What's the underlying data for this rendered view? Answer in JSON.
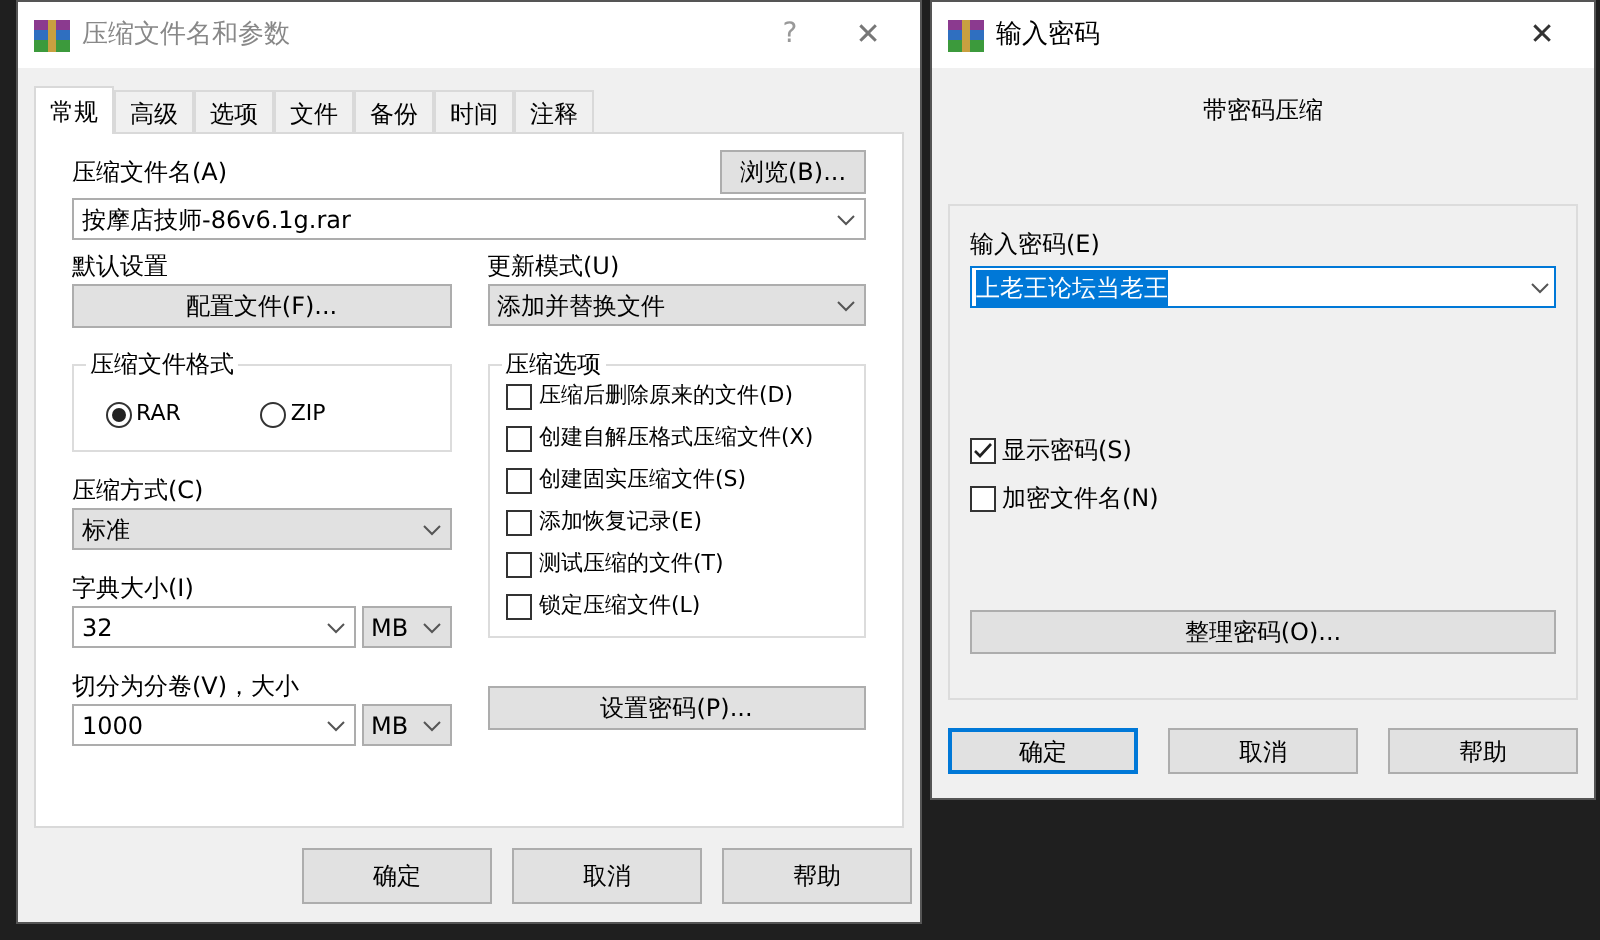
{
  "main_dialog": {
    "title": "压缩文件名和参数",
    "help_glyph": "?",
    "close_glyph": "✕",
    "tabs": [
      {
        "label": "常规",
        "selected": true
      },
      {
        "label": "高级",
        "selected": false
      },
      {
        "label": "选项",
        "selected": false
      },
      {
        "label": "文件",
        "selected": false
      },
      {
        "label": "备份",
        "selected": false
      },
      {
        "label": "时间",
        "selected": false
      },
      {
        "label": "注释",
        "selected": false
      }
    ],
    "archive_name": {
      "label": "压缩文件名(A)",
      "browse_button": "浏览(B)...",
      "value": "按摩店技师-86v6.1g.rar"
    },
    "default_settings": {
      "label": "默认设置",
      "button": "配置文件(F)..."
    },
    "update_mode": {
      "label": "更新模式(U)",
      "value": "添加并替换文件"
    },
    "archive_format": {
      "label": "压缩文件格式",
      "options": [
        {
          "label": "RAR",
          "selected": true
        },
        {
          "label": "ZIP",
          "selected": false
        }
      ]
    },
    "compression_method": {
      "label": "压缩方式(C)",
      "value": "标准"
    },
    "dictionary_size": {
      "label": "字典大小(I)",
      "value": "32",
      "unit": "MB"
    },
    "split_volumes": {
      "label": "切分为分卷(V)，大小",
      "value": "1000",
      "unit": "MB"
    },
    "options": {
      "label": "压缩选项",
      "items": [
        {
          "label": "压缩后删除原来的文件(D)",
          "checked": false
        },
        {
          "label": "创建自解压格式压缩文件(X)",
          "checked": false
        },
        {
          "label": "创建固实压缩文件(S)",
          "checked": false
        },
        {
          "label": "添加恢复记录(E)",
          "checked": false
        },
        {
          "label": "测试压缩的文件(T)",
          "checked": false
        },
        {
          "label": "锁定压缩文件(L)",
          "checked": false
        }
      ]
    },
    "set_password_button": "设置密码(P)...",
    "buttons": [
      "确定",
      "取消",
      "帮助"
    ]
  },
  "password_dialog": {
    "title": "输入密码",
    "close_glyph": "✕",
    "subtitle": "带密码压缩",
    "password": {
      "label": "输入密码(E)",
      "value": "上老王论坛当老王"
    },
    "checkboxes": [
      {
        "label": "显示密码(S)",
        "checked": true
      },
      {
        "label": "加密文件名(N)",
        "checked": false
      }
    ],
    "organize_button": "整理密码(O)...",
    "buttons": [
      {
        "label": "确定",
        "selected": true
      },
      {
        "label": "取消",
        "selected": false
      },
      {
        "label": "帮助",
        "selected": false
      }
    ]
  }
}
